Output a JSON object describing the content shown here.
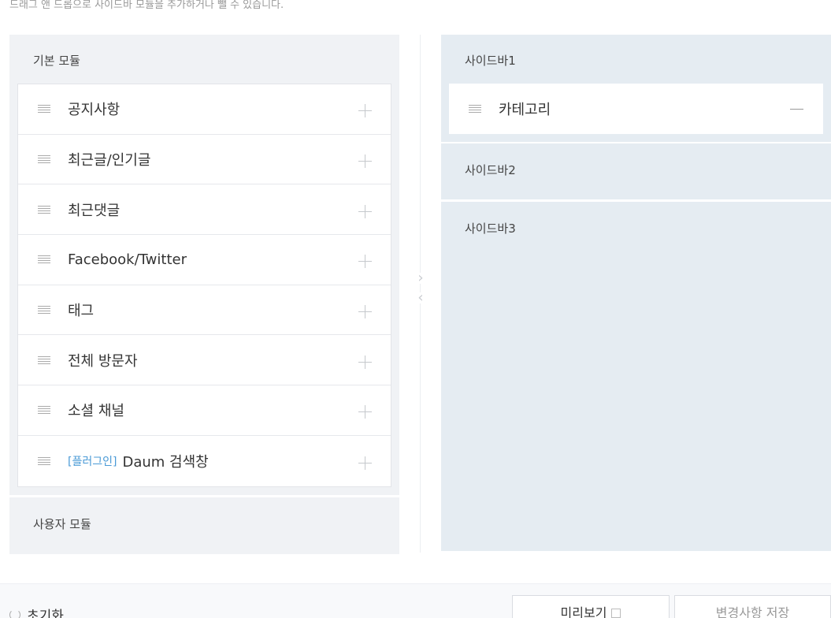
{
  "hint": "드래그 앤 드롭으로 사이드바 모듈을 추가하거나 뺄 수 있습니다.",
  "basic_modules": {
    "title": "기본 모듈",
    "items": [
      {
        "label": "공지사항"
      },
      {
        "label": "최근글/인기글"
      },
      {
        "label": "최근댓글"
      },
      {
        "label": "Facebook/Twitter"
      },
      {
        "label": "태그"
      },
      {
        "label": "전체 방문자"
      },
      {
        "label": "소셜 채널"
      },
      {
        "tag": "[플러그인]",
        "label": "Daum 검색창"
      }
    ]
  },
  "user_modules": {
    "title": "사용자 모듈"
  },
  "sidebars": [
    {
      "title": "사이드바1",
      "items": [
        {
          "label": "카테고리"
        }
      ]
    },
    {
      "title": "사이드바2"
    },
    {
      "title": "사이드바3"
    }
  ],
  "footer": {
    "reset_label": "초기화",
    "preview_label": "미리보기",
    "save_label": "변경사항 저장"
  },
  "colors": {
    "panel_bg": "#f0f2f5",
    "sidebar_bg": "#e5ecf2",
    "plugin_tag": "#4a9ad6"
  }
}
